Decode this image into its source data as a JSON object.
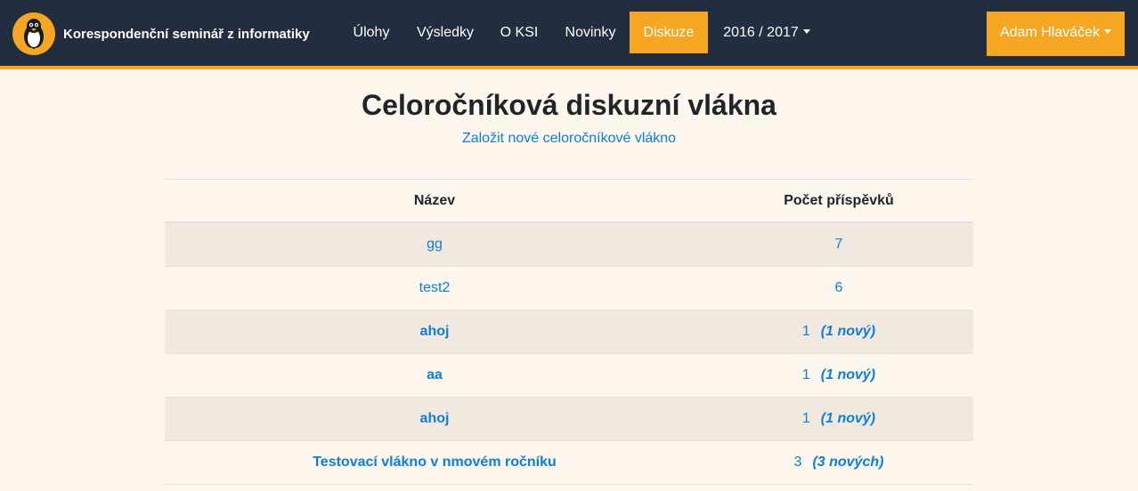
{
  "brand": {
    "name": "Korespondenční seminář z informatiky"
  },
  "nav": {
    "items": [
      {
        "label": "Úlohy"
      },
      {
        "label": "Výsledky"
      },
      {
        "label": "O KSI"
      },
      {
        "label": "Novinky"
      },
      {
        "label": "Diskuze",
        "active": true
      },
      {
        "label": "2016 / 2017",
        "dropdown": true
      }
    ],
    "user": "Adam Hlaváček"
  },
  "page": {
    "title": "Celoročníková diskuzní vlákna",
    "new_thread_link": "Založit nové celoročníkové vlákno"
  },
  "table": {
    "headers": [
      "Název",
      "Počet příspěvků"
    ],
    "rows": [
      {
        "name": "gg",
        "count": "7",
        "new": ""
      },
      {
        "name": "test2",
        "count": "6",
        "new": ""
      },
      {
        "name": "ahoj",
        "count": "1",
        "new": "(1 nový)"
      },
      {
        "name": "aa",
        "count": "1",
        "new": "(1 nový)"
      },
      {
        "name": "ahoj",
        "count": "1",
        "new": "(1 nový)"
      },
      {
        "name": "Testovací vlákno v nmovém ročníku",
        "count": "3",
        "new": "(3 nových)"
      }
    ]
  },
  "colors": {
    "navbar": "#222d3f",
    "accent": "#f5a623",
    "link": "#0d7de0",
    "background": "#fdf6ec"
  },
  "icons": {
    "logo": "penguin-logo-icon"
  }
}
